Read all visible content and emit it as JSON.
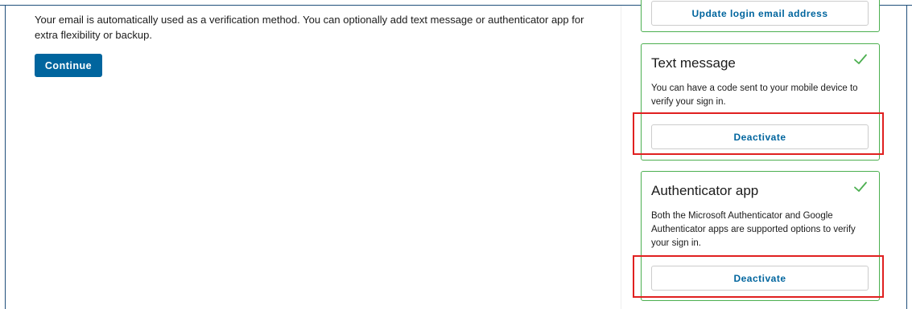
{
  "main": {
    "intro_text": "Your email is automatically used as a verification method. You can optionally add text message or authenticator app for extra flexibility or backup.",
    "continue_label": "Continue"
  },
  "cards": {
    "email": {
      "button_label": "Update login email address"
    },
    "sms": {
      "title": "Text message",
      "description": "You can have a code sent to your mobile device to verify your sign in.",
      "button_label": "Deactivate",
      "status_icon": "check-icon"
    },
    "authenticator": {
      "title": "Authenticator app",
      "description": "Both the Microsoft Authenticator and Google Authenticator apps are supported options to verify your sign in.",
      "button_label": "Deactivate",
      "status_icon": "check-icon"
    }
  },
  "colors": {
    "primary": "#00659e",
    "success": "#4caf50",
    "highlight": "#e02020"
  }
}
